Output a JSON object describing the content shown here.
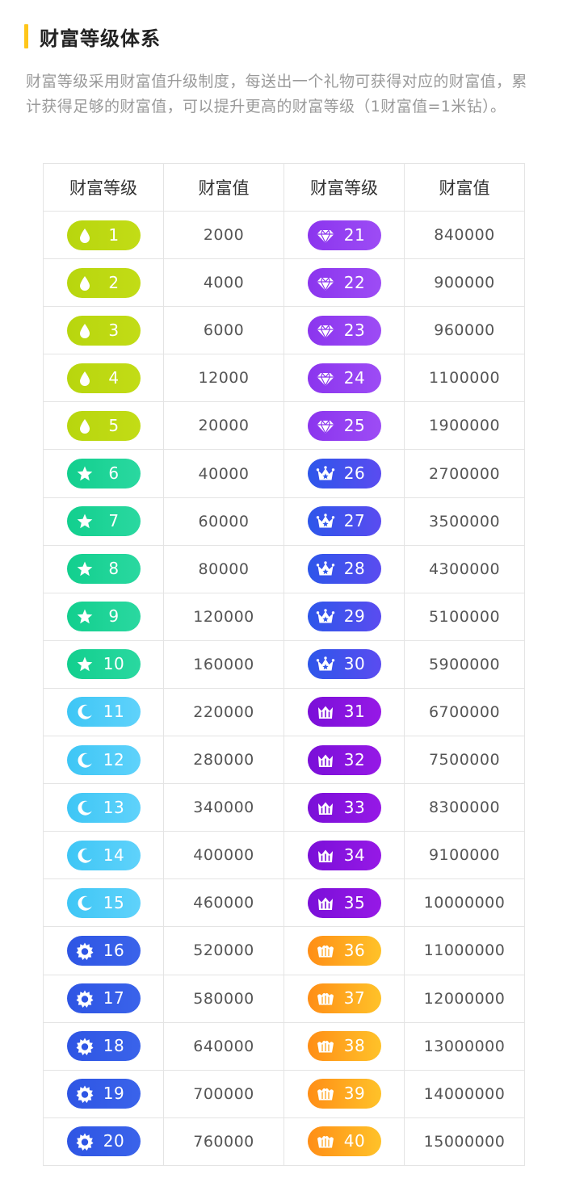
{
  "title": "财富等级体系",
  "description": "财富等级采用财富值升级制度，每送出一个礼物可获得对应的财富值，累计获得足够的财富值，可以提升更高的财富等级（1财富值=1米钻）。",
  "table": {
    "headers": [
      "财富等级",
      "财富值",
      "财富等级",
      "财富值"
    ]
  },
  "tiers": [
    {
      "icon": "droplet-icon",
      "colors": [
        "#b8d60e",
        "#c2dc16"
      ]
    },
    {
      "icon": "star-icon",
      "colors": [
        "#12cf8e",
        "#2ad8a0"
      ]
    },
    {
      "icon": "moon-icon",
      "colors": [
        "#3ec6f5",
        "#5fd2fb"
      ]
    },
    {
      "icon": "sun-icon",
      "colors": [
        "#2e55e4",
        "#3a63ea"
      ]
    },
    {
      "icon": "diamond-icon",
      "colors": [
        "#8b35ee",
        "#9d4cf5"
      ]
    },
    {
      "icon": "crown-icon",
      "colors": [
        "#2d56ea",
        "#5a4cf0"
      ]
    },
    {
      "icon": "king-crown-icon",
      "colors": [
        "#7a0fd8",
        "#9619e6"
      ]
    },
    {
      "icon": "royal-crown-icon",
      "colors": [
        "#ff8e16",
        "#ffc229"
      ]
    }
  ],
  "levels": [
    {
      "level": "1",
      "value": "2000"
    },
    {
      "level": "2",
      "value": "4000"
    },
    {
      "level": "3",
      "value": "6000"
    },
    {
      "level": "4",
      "value": "12000"
    },
    {
      "level": "5",
      "value": "20000"
    },
    {
      "level": "6",
      "value": "40000"
    },
    {
      "level": "7",
      "value": "60000"
    },
    {
      "level": "8",
      "value": "80000"
    },
    {
      "level": "9",
      "value": "120000"
    },
    {
      "level": "10",
      "value": "160000"
    },
    {
      "level": "11",
      "value": "220000"
    },
    {
      "level": "12",
      "value": "280000"
    },
    {
      "level": "13",
      "value": "340000"
    },
    {
      "level": "14",
      "value": "400000"
    },
    {
      "level": "15",
      "value": "460000"
    },
    {
      "level": "16",
      "value": "520000"
    },
    {
      "level": "17",
      "value": "580000"
    },
    {
      "level": "18",
      "value": "640000"
    },
    {
      "level": "19",
      "value": "700000"
    },
    {
      "level": "20",
      "value": "760000"
    },
    {
      "level": "21",
      "value": "840000"
    },
    {
      "level": "22",
      "value": "900000"
    },
    {
      "level": "23",
      "value": "960000"
    },
    {
      "level": "24",
      "value": "1100000"
    },
    {
      "level": "25",
      "value": "1900000"
    },
    {
      "level": "26",
      "value": "2700000"
    },
    {
      "level": "27",
      "value": "3500000"
    },
    {
      "level": "28",
      "value": "4300000"
    },
    {
      "level": "29",
      "value": "5100000"
    },
    {
      "level": "30",
      "value": "5900000"
    },
    {
      "level": "31",
      "value": "6700000"
    },
    {
      "level": "32",
      "value": "7500000"
    },
    {
      "level": "33",
      "value": "8300000"
    },
    {
      "level": "34",
      "value": "9100000"
    },
    {
      "level": "35",
      "value": "10000000"
    },
    {
      "level": "36",
      "value": "11000000"
    },
    {
      "level": "37",
      "value": "12000000"
    },
    {
      "level": "38",
      "value": "13000000"
    },
    {
      "level": "39",
      "value": "14000000"
    },
    {
      "level": "40",
      "value": "15000000"
    }
  ]
}
